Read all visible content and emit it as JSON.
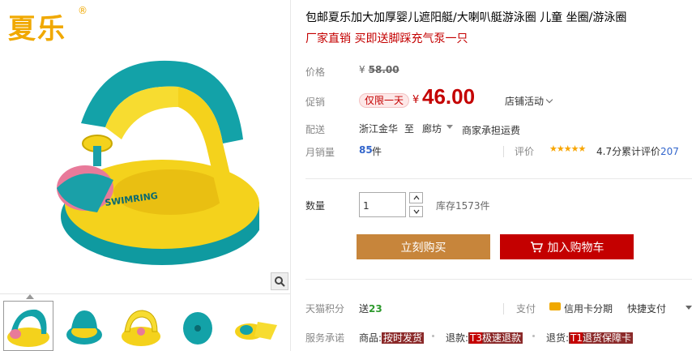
{
  "brand": {
    "logo_text": "夏乐",
    "reg_mark": "®"
  },
  "product": {
    "title": "包邮夏乐加大加厚婴儿遮阳艇/大喇叭艇游泳圈 儿童 坐圈/游泳圈",
    "subtitle": "厂家直销 买即送脚踩充气泵一只",
    "image_text": "SWIMRING"
  },
  "price": {
    "label": "价格",
    "currency": "¥",
    "original": "58.00"
  },
  "promo": {
    "label": "促销",
    "tag": "仅限一天",
    "currency": "¥",
    "price": "46.00",
    "shop_activity": "店铺活动"
  },
  "shipping": {
    "label": "配送",
    "from": "浙江金华",
    "to_label": "至",
    "destination": "廊坊",
    "fee": "商家承担运费"
  },
  "sales": {
    "label": "月销量",
    "count": "85",
    "unit": "件",
    "rating_label": "评价",
    "stars": "★★★★★",
    "score": "4.7分",
    "reviews_prefix": "累计评价",
    "reviews_count": "207"
  },
  "quantity": {
    "label": "数量",
    "value": "1",
    "stock": "库存1573件"
  },
  "actions": {
    "buy_now": "立刻购买",
    "add_cart": "加入购物车"
  },
  "points": {
    "label": "天猫积分",
    "prefix": "送",
    "value": "23"
  },
  "payment": {
    "label": "支付",
    "option": "信用卡分期",
    "quick": "快捷支付"
  },
  "services": {
    "label": "服务承诺",
    "items": [
      {
        "prefix": "商品:",
        "tag": "按时发货"
      },
      {
        "prefix": "退款:",
        "t": "T3",
        "tag": "极速退款"
      },
      {
        "prefix": "退货:",
        "t": "T1",
        "tag": "退货保障卡"
      }
    ]
  },
  "thumbnails": [
    "thumb-1",
    "thumb-2",
    "thumb-3",
    "thumb-4",
    "thumb-5"
  ]
}
